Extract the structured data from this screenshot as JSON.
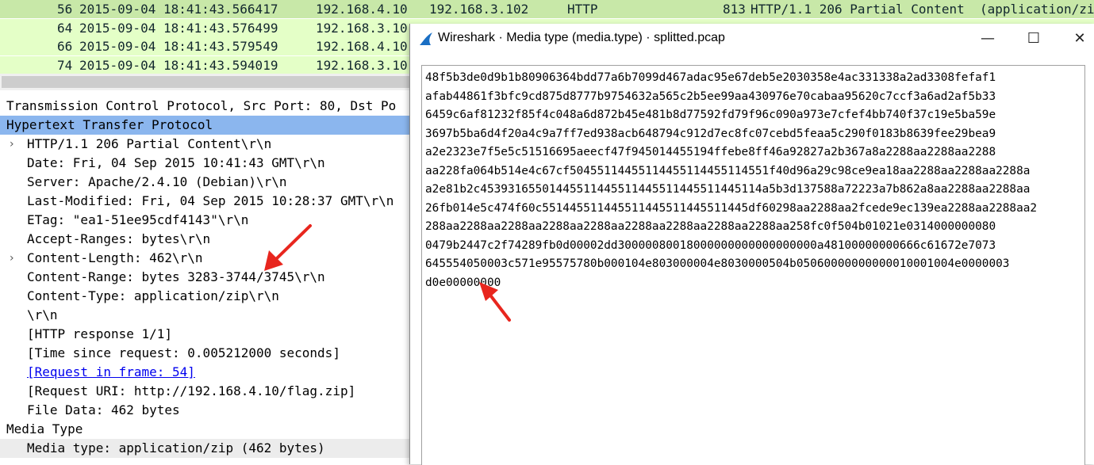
{
  "packet_list": {
    "rows": [
      {
        "no": "56",
        "time": "2015-09-04 18:41:43.566417",
        "src": "192.168.4.10",
        "dst": "192.168.3.102",
        "proto": "HTTP",
        "len": "813",
        "info": "HTTP/1.1 206 Partial Content  (application/zi"
      },
      {
        "no": "64",
        "time": "2015-09-04 18:41:43.576499",
        "src": "192.168.3.10",
        "dst": "",
        "proto": "",
        "len": "",
        "info": ""
      },
      {
        "no": "66",
        "time": "2015-09-04 18:41:43.579549",
        "src": "192.168.4.10",
        "dst": "",
        "proto": "",
        "len": "",
        "info": ""
      },
      {
        "no": "74",
        "time": "2015-09-04 18:41:43.594019",
        "src": "192.168.3.10",
        "dst": "",
        "proto": "",
        "len": "",
        "info": ""
      }
    ],
    "row_colors": [
      "#c8e8a8",
      "#e4ffc7",
      "#e4ffc7",
      "#e4ffc7"
    ]
  },
  "details": {
    "rows": [
      {
        "text": "Transmission Control Protocol, Src Port: 80, Dst Po",
        "indent": 0,
        "expandable": false,
        "selected": false
      },
      {
        "text": "Hypertext Transfer Protocol",
        "indent": 0,
        "expandable": false,
        "selected": true
      },
      {
        "text": "HTTP/1.1 206 Partial Content\\r\\n",
        "indent": 1,
        "expandable": true,
        "selected": false
      },
      {
        "text": "Date: Fri, 04 Sep 2015 10:41:43 GMT\\r\\n",
        "indent": 1,
        "expandable": false,
        "selected": false
      },
      {
        "text": "Server: Apache/2.4.10 (Debian)\\r\\n",
        "indent": 1,
        "expandable": false,
        "selected": false
      },
      {
        "text": "Last-Modified: Fri, 04 Sep 2015 10:28:37 GMT\\r\\n",
        "indent": 1,
        "expandable": false,
        "selected": false
      },
      {
        "text": "ETag: \"ea1-51ee95cdf4143\"\\r\\n",
        "indent": 1,
        "expandable": false,
        "selected": false
      },
      {
        "text": "Accept-Ranges: bytes\\r\\n",
        "indent": 1,
        "expandable": false,
        "selected": false
      },
      {
        "text": "Content-Length: 462\\r\\n",
        "indent": 1,
        "expandable": true,
        "selected": false
      },
      {
        "text": "Content-Range: bytes 3283-3744/3745\\r\\n",
        "indent": 1,
        "expandable": false,
        "selected": false
      },
      {
        "text": "Content-Type: application/zip\\r\\n",
        "indent": 1,
        "expandable": false,
        "selected": false
      },
      {
        "text": "\\r\\n",
        "indent": 1,
        "expandable": false,
        "selected": false
      },
      {
        "text": "[HTTP response 1/1]",
        "indent": 1,
        "expandable": false,
        "selected": false
      },
      {
        "text": "[Time since request: 0.005212000 seconds]",
        "indent": 1,
        "expandable": false,
        "selected": false
      },
      {
        "text": "[Request in frame: 54]",
        "indent": 1,
        "expandable": false,
        "selected": false,
        "link": true
      },
      {
        "text": "[Request URI: http://192.168.4.10/flag.zip]",
        "indent": 1,
        "expandable": false,
        "selected": false
      },
      {
        "text": "File Data: 462 bytes",
        "indent": 1,
        "expandable": false,
        "selected": false
      },
      {
        "text": "Media Type",
        "indent": 0,
        "expandable": false,
        "selected": false
      },
      {
        "text": "Media type: application/zip (462 bytes)",
        "indent": 1,
        "expandable": false,
        "selected": false,
        "highlight": true
      }
    ]
  },
  "dialog": {
    "title": "Wireshark · Media type (media.type) · splitted.pcap",
    "minimize_glyph": "—",
    "maximize_glyph": "☐",
    "close_glyph": "✕",
    "hex_lines": [
      "48f5b3de0d9b1b80906364bdd77a6b7099d467adac95e67deb5e2030358e4ac331338a2ad3308fefaf1",
      "afab44861f3bfc9cd875d8777b9754632a565c2b5ee99aa430976e70cabaa95620c7ccf3a6ad2af5b33",
      "6459c6af81232f85f4c048a6d872b45e481b8d77592fd79f96c090a973e7cfef4bb740f37c19e5ba59e",
      "3697b5ba6d4f20a4c9a7ff7ed938acb648794c912d7ec8fc07cebd5feaa5c290f0183b8639fee29bea9",
      "a2e2323e7f5e5c51516695aeecf47f945014455194ffebe8ff46a92827a2b367a8a2288aa2288aa2288",
      "aa228fa064b514e4c67cf50455114455114455114455114551f40d96a29c98ce9ea18aa2288aa2288aa2288a",
      "a2e81b2c45393165501445511445511445511445511445114a5b3d137588a72223a7b862a8aa2288aa2288aa",
      "26fb014e5c474f60c551445511445511445511445511445df60298aa2288aa2fcede9ec139ea2288aa2288aa2",
      "288aa2288aa2288aa2288aa2288aa2288aa2288aa2288aa2288aa258fc0f504b01021e0314000000080",
      "0479b2447c2f74289fb0d00002dd30000080018000000000000000000a48100000000666c61672e7073",
      "645554050003c571e95575780b000104e803000004e8030000504b05060000000000010001004e0000003",
      "d0e00000000"
    ]
  },
  "colors": {
    "selected_row": "#8bb6ee",
    "highlight_row": "#ececec",
    "annotation_arrow": "#e8261e"
  }
}
